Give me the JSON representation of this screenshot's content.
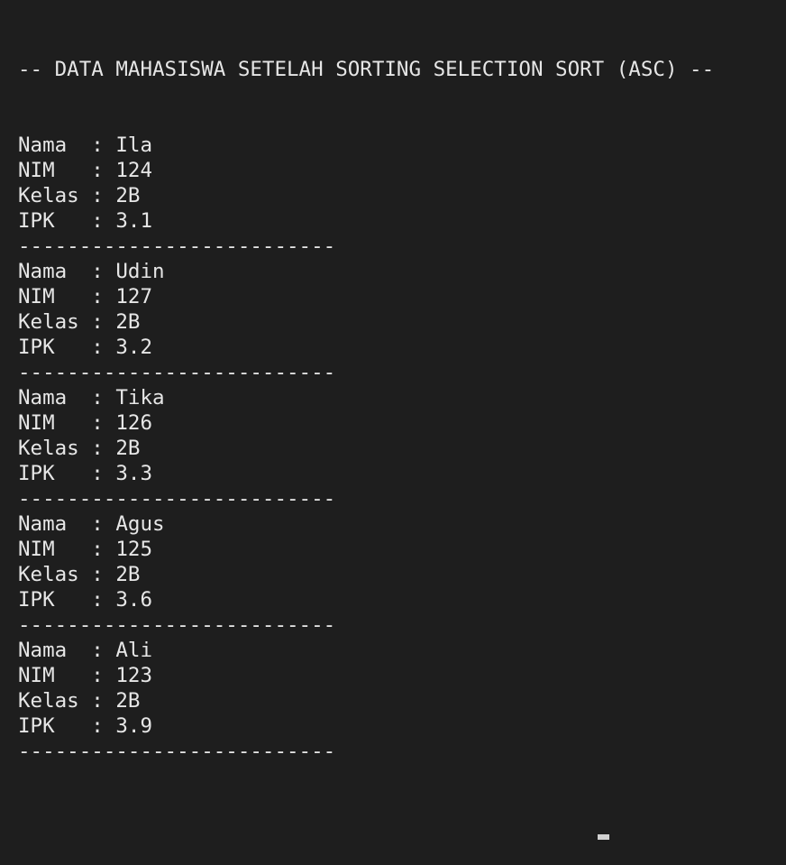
{
  "terminal": {
    "header": "-- DATA MAHASISWA SETELAH SORTING SELECTION SORT (ASC) --",
    "labels": {
      "nama": "Nama  : ",
      "nim": "NIM   : ",
      "kelas": "Kelas : ",
      "ipk": "IPK   : "
    },
    "separator": "--------------------------",
    "records": [
      {
        "nama": "Ila",
        "nim": "124",
        "kelas": "2B",
        "ipk": "3.1"
      },
      {
        "nama": "Udin",
        "nim": "127",
        "kelas": "2B",
        "ipk": "3.2"
      },
      {
        "nama": "Tika",
        "nim": "126",
        "kelas": "2B",
        "ipk": "3.3"
      },
      {
        "nama": "Agus",
        "nim": "125",
        "kelas": "2B",
        "ipk": "3.6"
      },
      {
        "nama": "Ali",
        "nim": "123",
        "kelas": "2B",
        "ipk": "3.9"
      }
    ]
  }
}
